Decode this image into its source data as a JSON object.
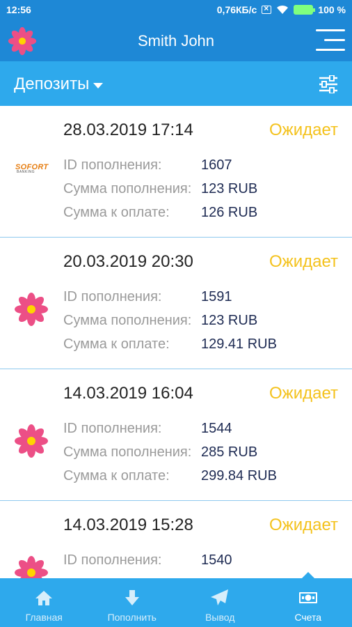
{
  "status_bar": {
    "time": "12:56",
    "speed": "0,76КБ/с",
    "battery": "100 %"
  },
  "header": {
    "title": "Smith John",
    "logo_icon": "flower-icon",
    "menu_icon": "hamburger-icon"
  },
  "sub_header": {
    "section": "Депозиты",
    "filter_icon": "sliders-icon"
  },
  "labels": {
    "id": "ID пополнения:",
    "amount": "Сумма пополнения:",
    "to_pay": "Сумма к оплате:"
  },
  "deposits": [
    {
      "date": "28.03.2019 17:14",
      "status": "Ожидает",
      "method": "sofort",
      "method_text": "SOFORT",
      "method_sub": "BANKING",
      "id": "1607",
      "amount": "123 RUB",
      "to_pay": "126 RUB"
    },
    {
      "date": "20.03.2019 20:30",
      "status": "Ожидает",
      "method": "flower",
      "id": "1591",
      "amount": "123 RUB",
      "to_pay": "129.41 RUB"
    },
    {
      "date": "14.03.2019 16:04",
      "status": "Ожидает",
      "method": "flower",
      "id": "1544",
      "amount": "285 RUB",
      "to_pay": "299.84 RUB"
    },
    {
      "date": "14.03.2019 15:28",
      "status": "Ожидает",
      "method": "flower",
      "id": "1540"
    }
  ],
  "nav": [
    {
      "label": "Главная",
      "icon": "home-icon",
      "active": false
    },
    {
      "label": "Пополнить",
      "icon": "arrow-down-icon",
      "active": false
    },
    {
      "label": "Вывод",
      "icon": "paper-plane-icon",
      "active": false
    },
    {
      "label": "Счета",
      "icon": "banknote-icon",
      "active": true
    }
  ],
  "colors": {
    "header": "#1e88d6",
    "sub_header": "#2ea9ec",
    "status_pending": "#f4c21c",
    "flower_petals": "#ec4f86",
    "flower_center": "#ffd400"
  }
}
